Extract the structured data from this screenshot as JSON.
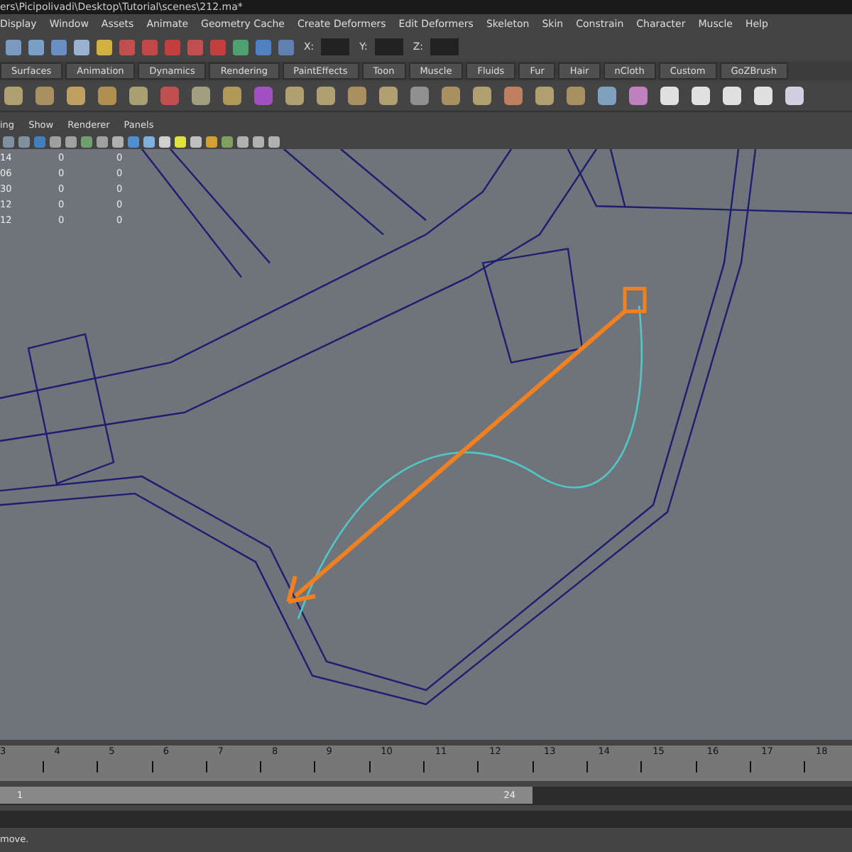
{
  "window": {
    "title": "ers\\Picipolivadi\\Desktop\\Tutorial\\scenes\\212.ma*"
  },
  "menu": [
    "Display",
    "Window",
    "Assets",
    "Animate",
    "Geometry Cache",
    "Create Deformers",
    "Edit Deformers",
    "Skeleton",
    "Skin",
    "Constrain",
    "Character",
    "Muscle",
    "Help"
  ],
  "status_line": {
    "fields": [
      "X:",
      "Y:",
      "Z:"
    ]
  },
  "shelf_tabs": [
    "Surfaces",
    "Animation",
    "Dynamics",
    "Rendering",
    "PaintEffects",
    "Toon",
    "Muscle",
    "Fluids",
    "Fur",
    "Hair",
    "nCloth",
    "Custom",
    "GoZBrush"
  ],
  "panel_menu": [
    "ing",
    "Show",
    "Renderer",
    "Panels"
  ],
  "hud": [
    [
      "14",
      "0",
      "0"
    ],
    [
      "06",
      "0",
      "0"
    ],
    [
      "30",
      "0",
      "0"
    ],
    [
      "12",
      "0",
      "0"
    ],
    [
      "12",
      "0",
      "0"
    ]
  ],
  "time_slider": {
    "ticks": [
      "3",
      "4",
      "5",
      "6",
      "7",
      "8",
      "9",
      "10",
      "11",
      "12",
      "13",
      "14",
      "15",
      "16",
      "17",
      "18"
    ]
  },
  "range_slider": {
    "start": "1",
    "end": "24",
    "level": 0.625
  },
  "help_line": "move."
}
